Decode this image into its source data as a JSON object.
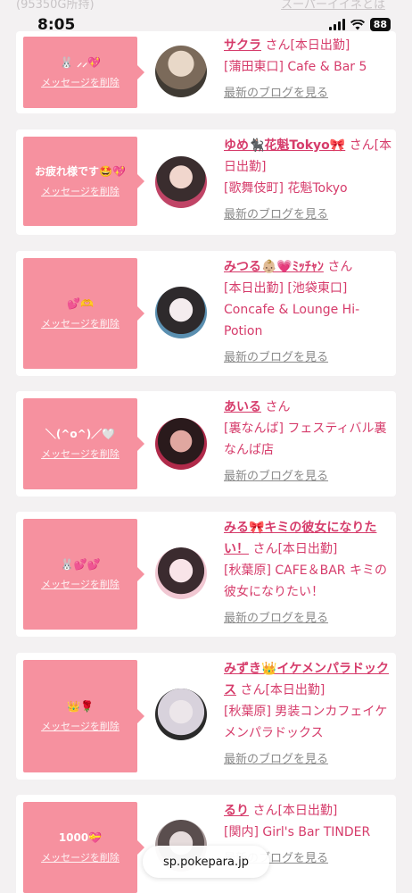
{
  "status": {
    "time": "8:05",
    "battery": "88",
    "top_left_faded": "(95350G所持)",
    "top_right_faded": "スーパーイイネとは"
  },
  "delete_label": "メッセージを削除",
  "blog_label": "最新のブログを見る",
  "cards": [
    {
      "message": "🐰 ⸝⸝💖",
      "name": "サクラ",
      "san": "さん[本日出勤]",
      "shop": "[蒲田東口] Cafe & Bar 5"
    },
    {
      "message": "お疲れ様です🤩💖",
      "name": "ゆめ🐈‍⬛花魁Tokyo🎀",
      "san": "さん[本日出勤]",
      "shop": "[歌舞伎町] 花魁Tokyo"
    },
    {
      "message": "💕🫶",
      "name": "みつる👶🏼💗ﾐｯﾁｬﾝ",
      "san": "さん",
      "shop": "[本日出勤] [池袋東口] Concafe & Lounge Hi-Potion"
    },
    {
      "message": "＼(^o^)／🤍",
      "name": "あいる",
      "san": "さん",
      "shop": "[裏なんば] フェスティバル裏なんば店"
    },
    {
      "message": "🐰💕💕",
      "name": "みる🎀キミの彼女になりたい！",
      "san": "さん[本日出勤]",
      "shop": "[秋葉原] CAFE＆BAR キミの彼女になりたい！"
    },
    {
      "message": "👑🌹",
      "name": "みずき👑イケメンパラドックス",
      "san": "さん[本日出勤]",
      "shop": "[秋葉原] 男装コンカフェイケメンパラドックス"
    },
    {
      "message": "1000💝",
      "name": "るり",
      "san": "さん[本日出勤]",
      "shop": "[関内] Girl's Bar TINDER"
    }
  ],
  "url": "sp.pokepara.jp"
}
